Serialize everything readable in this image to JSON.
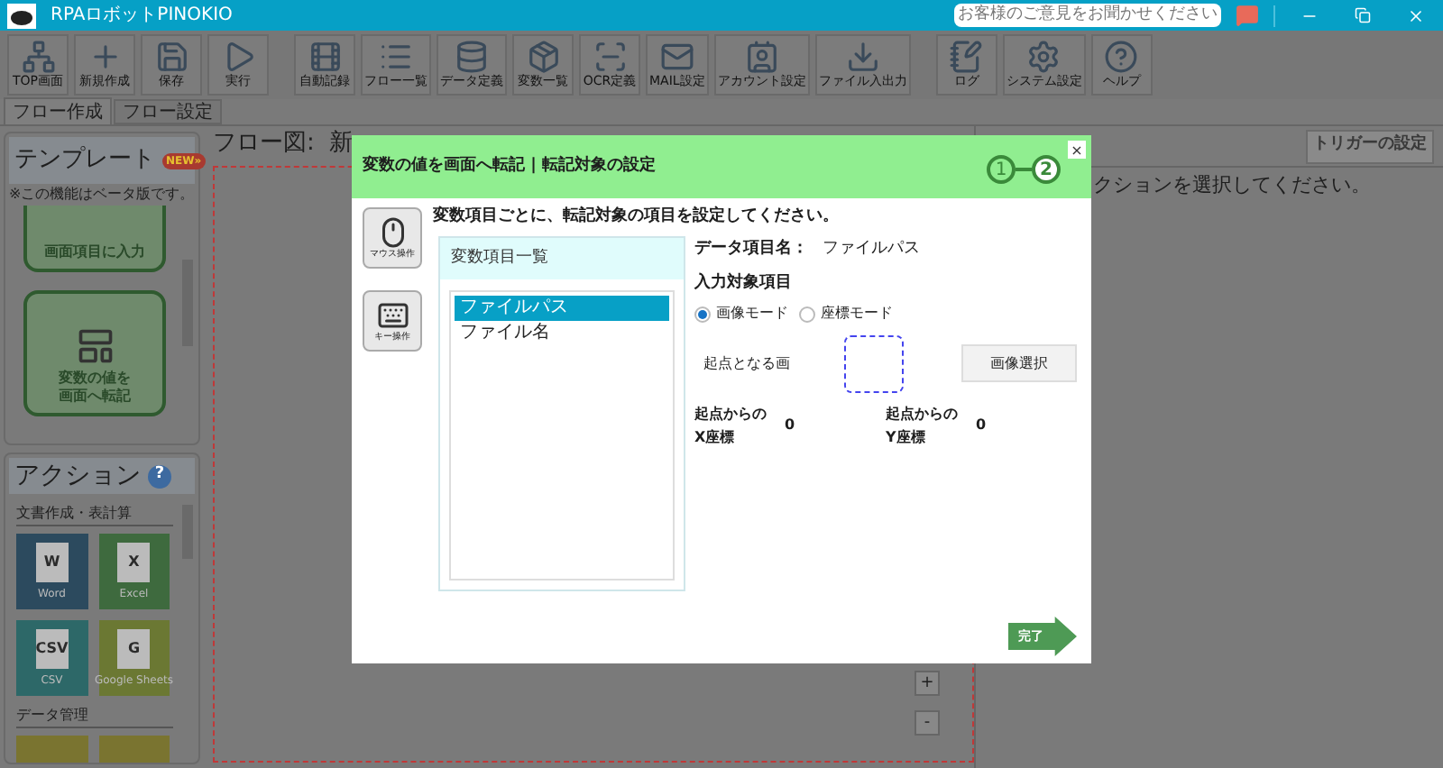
{
  "window": {
    "title": "RPAロボットPINOKIO",
    "feedback": "お客様のご意見をお聞かせください"
  },
  "toolbar": [
    {
      "label": "TOP画面"
    },
    {
      "label": "新規作成"
    },
    {
      "label": "保存"
    },
    {
      "label": "実行"
    },
    {
      "label": "自動記録"
    },
    {
      "label": "フロー一覧"
    },
    {
      "label": "データ定義"
    },
    {
      "label": "変数一覧"
    },
    {
      "label": "OCR定義"
    },
    {
      "label": "MAIL設定"
    },
    {
      "label": "アカウント設定"
    },
    {
      "label": "ファイル入出力"
    },
    {
      "label": "ログ"
    },
    {
      "label": "システム設定"
    },
    {
      "label": "ヘルプ"
    }
  ],
  "tabs": [
    {
      "label": "フロー作成",
      "selected": true
    },
    {
      "label": "フロー設定",
      "selected": false
    }
  ],
  "template_panel": {
    "title": "テンプレート",
    "badge": "NEW»",
    "note": "※この機能はベータ版です。",
    "cards": [
      {
        "lines": [
          "画面項目に入力"
        ]
      },
      {
        "lines": [
          "変数の値を",
          "画面へ転記"
        ]
      }
    ]
  },
  "action_panel": {
    "title": "アクション",
    "help": "?",
    "categories": [
      {
        "name": "文書作成・表計算",
        "tiles": [
          {
            "letter": "W",
            "label": "Word",
            "color": "#2c4a5e"
          },
          {
            "letter": "X",
            "label": "Excel",
            "color": "#3e6a3e"
          },
          {
            "letter": "CSV",
            "label": "CSV",
            "color": "#2d6868"
          },
          {
            "letter": "G",
            "label": "Google Sheets",
            "color": "#6b7833"
          }
        ]
      },
      {
        "name": "データ管理",
        "tiles": [
          {
            "color": "#7a7430"
          },
          {
            "color": "#7a7430"
          }
        ]
      }
    ]
  },
  "flow": {
    "title": "フロー図:  新",
    "zoom_in": "+",
    "zoom_out": "-"
  },
  "right_panel": {
    "trigger_button": "トリガーの設定",
    "hint": "クションを選択してください。"
  },
  "dialog": {
    "title": "変数の値を画面へ転記 | 転記対象の設定",
    "steps": [
      {
        "label": "1",
        "selected": false
      },
      {
        "label": "2",
        "selected": true
      }
    ],
    "close": "×",
    "tools": [
      {
        "label": "マウス操作"
      },
      {
        "label": "キー操作"
      }
    ],
    "instruction": "変数項目ごとに、転記対象の項目を設定してください。",
    "variable_list": {
      "title": "変数項目一覧",
      "items": [
        {
          "label": "ファイルパス",
          "selected": true
        },
        {
          "label": "ファイル名",
          "selected": false
        }
      ]
    },
    "data_item_label": "データ項目名：",
    "data_item_value": "ファイルパス",
    "input_target_label": "入力対象項目",
    "modes": [
      {
        "label": "画像モード",
        "selected": true
      },
      {
        "label": "座標モード",
        "selected": false
      }
    ],
    "origin_image_label": "起点となる画",
    "image_select_button": "画像選択",
    "offsets": [
      {
        "label_lines": [
          "起点からの",
          "X座標"
        ],
        "value": "0"
      },
      {
        "label_lines": [
          "起点からの",
          "Y座標"
        ],
        "value": "0"
      }
    ],
    "done_button": "完了"
  }
}
